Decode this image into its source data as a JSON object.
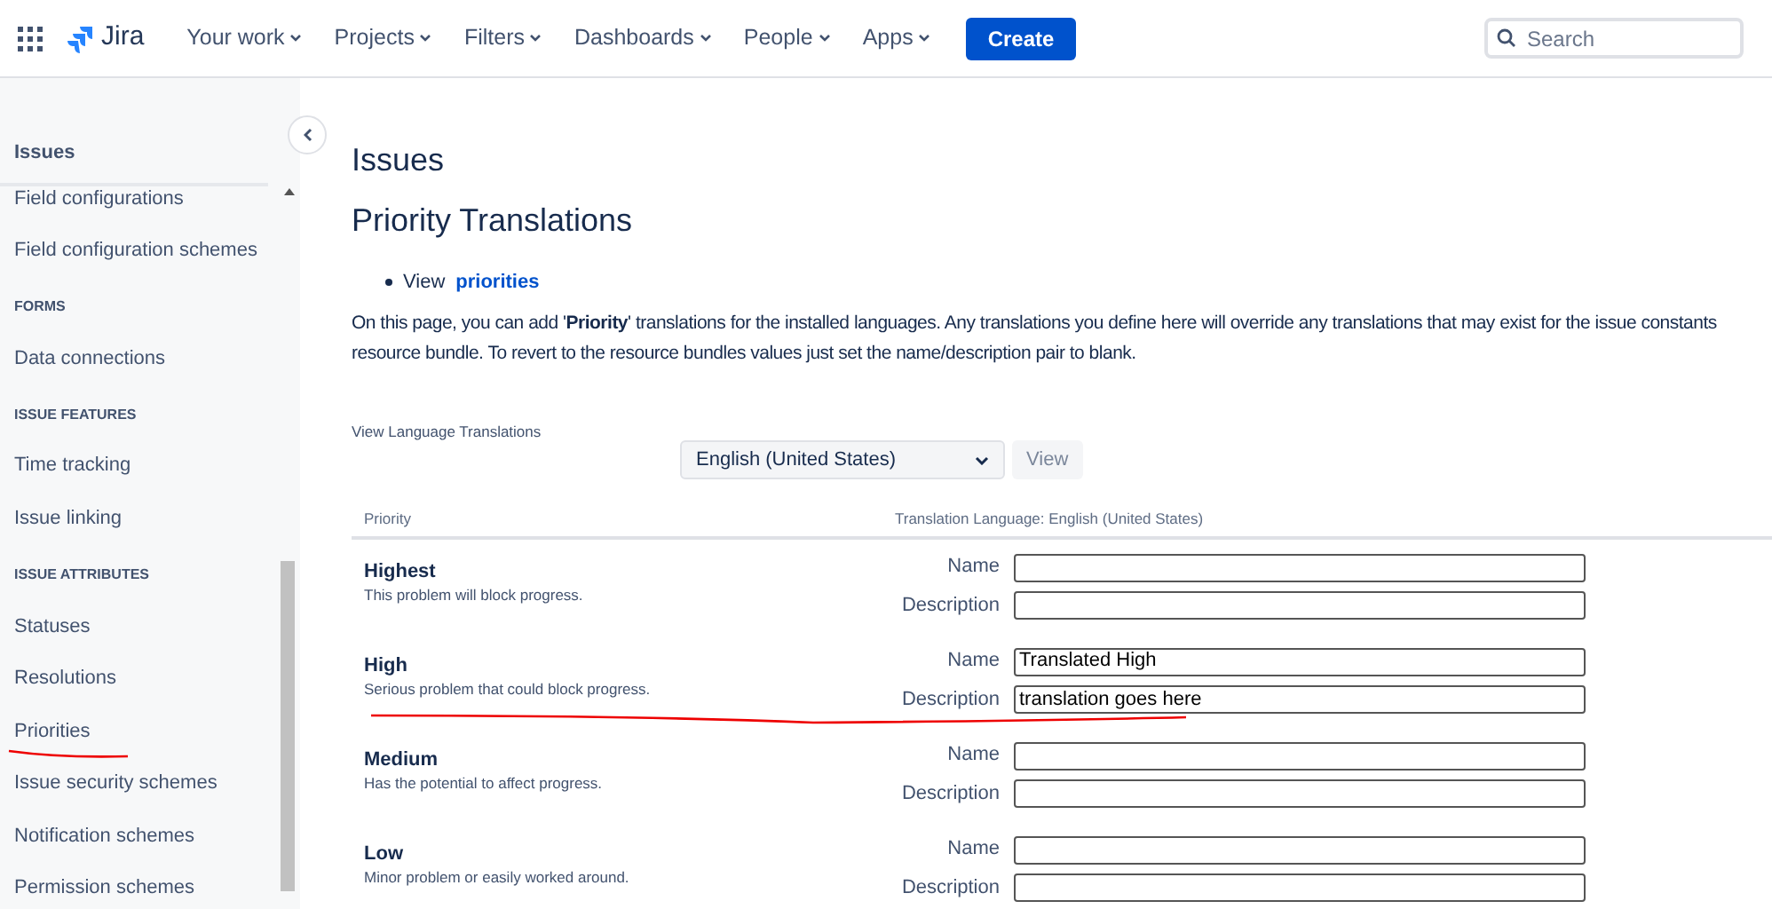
{
  "nav": {
    "app_name": "Jira",
    "menus": [
      {
        "label": "Your work"
      },
      {
        "label": "Projects"
      },
      {
        "label": "Filters"
      },
      {
        "label": "Dashboards"
      },
      {
        "label": "People"
      },
      {
        "label": "Apps"
      }
    ],
    "create_button": "Create",
    "search": {
      "placeholder": "Search"
    }
  },
  "sidebar": {
    "title": "Issues",
    "items": [
      {
        "kind": "link",
        "label": "Field configurations"
      },
      {
        "kind": "link",
        "label": "Field configuration schemes"
      },
      {
        "kind": "heading",
        "label": "FORMS"
      },
      {
        "kind": "link",
        "label": "Data connections"
      },
      {
        "kind": "heading",
        "label": "ISSUE FEATURES"
      },
      {
        "kind": "link",
        "label": "Time tracking"
      },
      {
        "kind": "link",
        "label": "Issue linking"
      },
      {
        "kind": "heading",
        "label": "ISSUE ATTRIBUTES"
      },
      {
        "kind": "link",
        "label": "Statuses"
      },
      {
        "kind": "link",
        "label": "Resolutions"
      },
      {
        "kind": "link",
        "label": "Priorities"
      },
      {
        "kind": "link",
        "label": "Issue security schemes"
      },
      {
        "kind": "link",
        "label": "Notification schemes"
      },
      {
        "kind": "link",
        "label": "Permission schemes"
      }
    ]
  },
  "page": {
    "title": "Issues",
    "subtitle": "Priority Translations",
    "bullet": {
      "text": "View",
      "link": "priorities"
    },
    "intro_lines": [
      "On this page, you can add '**Priority**' translations for the installed languages. Any translations you define here will override any translations that may exist for the issue constants",
      "resource bundle. To revert to the resource bundles values just set the name/description pair to blank."
    ],
    "language_label": "View Language Translations",
    "language_select": "English (United States)",
    "view_button": "View",
    "table": {
      "columns": [
        "Priority",
        "Translation Language: English (United States)"
      ],
      "rows": [
        {
          "name": "Highest",
          "description": "This problem will block progress.",
          "fields": [
            {
              "label": "Name"
            },
            {
              "label": "Description"
            }
          ]
        },
        {
          "name": "High",
          "description": "Serious problem that could block progress.",
          "fields": [
            {
              "label": "Name",
              "value": "Translated High"
            },
            {
              "label": "Description",
              "value": "translation goes here"
            }
          ]
        },
        {
          "name": "Medium",
          "description": "Has the potential to affect progress.",
          "fields": [
            {
              "label": "Name"
            },
            {
              "label": "Description"
            }
          ]
        },
        {
          "name": "Low",
          "description": "Minor problem or easily worked around.",
          "fields": [
            {
              "label": "Name"
            },
            {
              "label": "Description"
            }
          ]
        }
      ]
    }
  }
}
